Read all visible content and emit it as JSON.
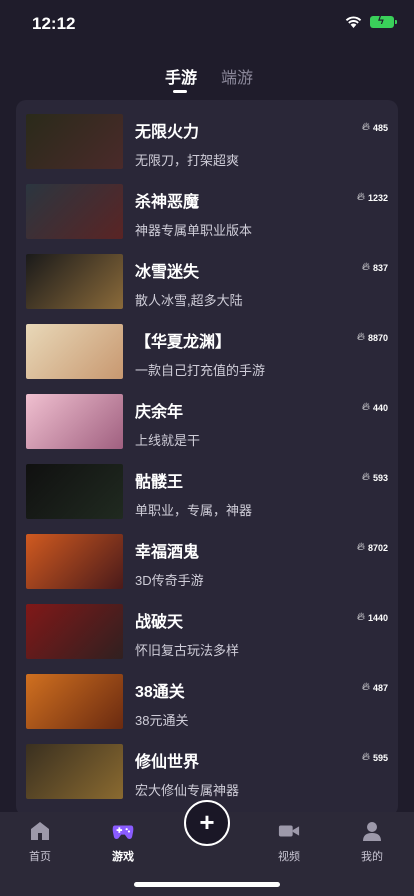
{
  "status": {
    "time": "12:12"
  },
  "tabs": {
    "active": "手游",
    "inactive": "端游"
  },
  "games": [
    {
      "name": "无限火力",
      "desc": "无限刀，打架超爽",
      "heat": "485",
      "thumb_text": "",
      "thumb_bg": "linear-gradient(135deg,#2a2a1a,#4a2a2a)"
    },
    {
      "name": "杀神恶魔",
      "desc": "神器专属单职业版本",
      "heat": "1232",
      "thumb_text": "",
      "thumb_bg": "linear-gradient(135deg,#2b3640,#5a2424)"
    },
    {
      "name": "冰雪迷失",
      "desc": "散人冰雪,超多大陆",
      "heat": "837",
      "thumb_text": "",
      "thumb_bg": "linear-gradient(135deg,#1a1a1a,#8a6a3a)"
    },
    {
      "name": "【华夏龙渊】",
      "desc": "一款自己打充值的手游",
      "heat": "8870",
      "thumb_text": "",
      "thumb_bg": "linear-gradient(135deg,#e8d8b8,#c89870)"
    },
    {
      "name": "庆余年",
      "desc": "上线就是干",
      "heat": "440",
      "thumb_text": "",
      "thumb_bg": "linear-gradient(135deg,#f0c0d0,#a06080)"
    },
    {
      "name": "骷髅王",
      "desc": "单职业，专属，神器",
      "heat": "593",
      "thumb_text": "",
      "thumb_bg": "linear-gradient(135deg,#101010,#202a20)"
    },
    {
      "name": "幸福酒鬼",
      "desc": "3D传奇手游",
      "heat": "8702",
      "thumb_text": "",
      "thumb_bg": "linear-gradient(135deg,#d05a20,#4a1a1a)"
    },
    {
      "name": "战破天",
      "desc": "怀旧复古玩法多样",
      "heat": "1440",
      "thumb_text": "",
      "thumb_bg": "linear-gradient(135deg,#801818,#302020)"
    },
    {
      "name": "38通关",
      "desc": "38元通关",
      "heat": "487",
      "thumb_text": "",
      "thumb_bg": "linear-gradient(135deg,#d07020,#6a2a10)"
    },
    {
      "name": "修仙世界",
      "desc": "宏大修仙专属神器",
      "heat": "595",
      "thumb_text": "",
      "thumb_bg": "linear-gradient(135deg,#3a3020,#8a6a30)"
    }
  ],
  "nav": {
    "home": "首页",
    "games": "游戏",
    "video": "视频",
    "mine": "我的"
  },
  "colors": {
    "background": "#1f1c2b",
    "card": "#2a2738",
    "accent_purple": "#8a5cff",
    "nav_bg": "#2c2938"
  }
}
